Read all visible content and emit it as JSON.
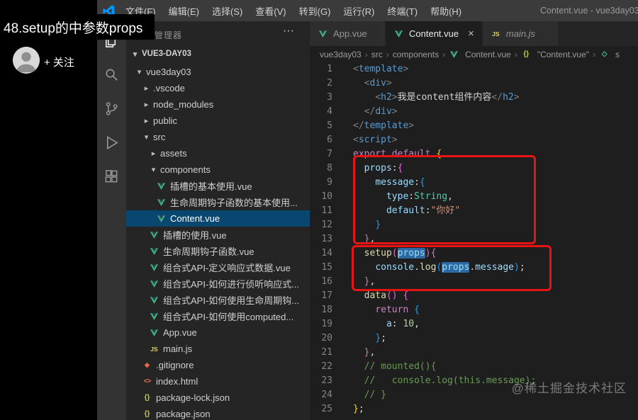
{
  "overlay": {
    "title": "48.setup的中参数props",
    "follow_label": "+ 关注"
  },
  "watermark": "@稀土掘金技术社区",
  "menubar": {
    "items": [
      "文件(F)",
      "编辑(E)",
      "选择(S)",
      "查看(V)",
      "转到(G)",
      "运行(R)",
      "终端(T)",
      "帮助(H)"
    ],
    "window_title": "Content.vue - vue3day03"
  },
  "activity_bar": {
    "icons": [
      "explorer",
      "search",
      "source-control",
      "run-debug",
      "extensions"
    ]
  },
  "explorer": {
    "header": "资源管理器",
    "actions_label": "···",
    "root": "VUE3-DAY03",
    "items": [
      {
        "label": "vue3day03",
        "type": "folder-open",
        "level": 0
      },
      {
        "label": ".vscode",
        "type": "folder",
        "level": 1
      },
      {
        "label": "node_modules",
        "type": "folder",
        "level": 1
      },
      {
        "label": "public",
        "type": "folder",
        "level": 1
      },
      {
        "label": "src",
        "type": "folder-open",
        "level": 1
      },
      {
        "label": "assets",
        "type": "folder",
        "level": 2
      },
      {
        "label": "components",
        "type": "folder-open",
        "level": 2
      },
      {
        "label": "插槽的基本使用.vue",
        "type": "vue",
        "level": 3
      },
      {
        "label": "生命周期钩子函数的基本使用...",
        "type": "vue",
        "level": 3
      },
      {
        "label": "Content.vue",
        "type": "vue",
        "level": 3,
        "selected": true
      },
      {
        "label": "插槽的使用.vue",
        "type": "vue",
        "level": 2
      },
      {
        "label": "生命周期钩子函数.vue",
        "type": "vue",
        "level": 2
      },
      {
        "label": "组合式API-定义响应式数据.vue",
        "type": "vue",
        "level": 2
      },
      {
        "label": "组合式API-如何进行侦听响应式...",
        "type": "vue",
        "level": 2
      },
      {
        "label": "组合式API-如何使用生命周期钩...",
        "type": "vue",
        "level": 2
      },
      {
        "label": "组合式API-如何使用computed...",
        "type": "vue",
        "level": 2
      },
      {
        "label": "App.vue",
        "type": "vue",
        "level": 2
      },
      {
        "label": "main.js",
        "type": "js",
        "level": 2
      },
      {
        "label": ".gitignore",
        "type": "git",
        "level": 1
      },
      {
        "label": "index.html",
        "type": "html",
        "level": 1
      },
      {
        "label": "package-lock.json",
        "type": "json",
        "level": 1
      },
      {
        "label": "package.json",
        "type": "json",
        "level": 1
      }
    ]
  },
  "tabs": [
    {
      "label": "App.vue",
      "icon": "vue"
    },
    {
      "label": "Content.vue",
      "icon": "vue",
      "active": true,
      "close_label": "×"
    },
    {
      "label": "main.js",
      "icon": "js",
      "italic": true
    }
  ],
  "breadcrumb": {
    "items": [
      {
        "label": "vue3day03"
      },
      {
        "label": "src"
      },
      {
        "label": "components"
      },
      {
        "label": "Content.vue",
        "icon": "vue"
      },
      {
        "label": "\"Content.vue\"",
        "icon": "json"
      },
      {
        "label": "s",
        "icon": "sym"
      }
    ]
  },
  "annotation": {
    "color": "#e81313"
  },
  "editor": {
    "lines": [
      {
        "n": 1,
        "tokens": [
          {
            "t": "<",
            "c": "punct"
          },
          {
            "t": "template",
            "c": "tag"
          },
          {
            "t": ">",
            "c": "punct"
          }
        ]
      },
      {
        "n": 2,
        "tokens": [
          {
            "t": "  ",
            "c": "text"
          },
          {
            "t": "<",
            "c": "punct"
          },
          {
            "t": "div",
            "c": "tag"
          },
          {
            "t": ">",
            "c": "punct"
          }
        ]
      },
      {
        "n": 3,
        "tokens": [
          {
            "t": "    ",
            "c": "text"
          },
          {
            "t": "<",
            "c": "punct"
          },
          {
            "t": "h2",
            "c": "tag"
          },
          {
            "t": ">",
            "c": "punct"
          },
          {
            "t": "我是content组件内容",
            "c": "text"
          },
          {
            "t": "</",
            "c": "punct"
          },
          {
            "t": "h2",
            "c": "tag"
          },
          {
            "t": ">",
            "c": "punct"
          }
        ]
      },
      {
        "n": 4,
        "tokens": [
          {
            "t": "  ",
            "c": "text"
          },
          {
            "t": "</",
            "c": "punct"
          },
          {
            "t": "div",
            "c": "tag"
          },
          {
            "t": ">",
            "c": "punct"
          }
        ]
      },
      {
        "n": 5,
        "tokens": [
          {
            "t": "</",
            "c": "punct"
          },
          {
            "t": "template",
            "c": "tag"
          },
          {
            "t": ">",
            "c": "punct"
          }
        ]
      },
      {
        "n": 6,
        "tokens": [
          {
            "t": "<",
            "c": "punct"
          },
          {
            "t": "script",
            "c": "tag"
          },
          {
            "t": ">",
            "c": "punct"
          }
        ]
      },
      {
        "n": 7,
        "tokens": [
          {
            "t": "export",
            "c": "kw"
          },
          {
            "t": " ",
            "c": "text"
          },
          {
            "t": "default",
            "c": "kw"
          },
          {
            "t": " ",
            "c": "text"
          },
          {
            "t": "{",
            "c": "b1"
          }
        ]
      },
      {
        "n": 8,
        "tokens": [
          {
            "t": "  ",
            "c": "text"
          },
          {
            "t": "props",
            "c": "prop"
          },
          {
            "t": ":",
            "c": "text"
          },
          {
            "t": "{",
            "c": "b2"
          }
        ]
      },
      {
        "n": 9,
        "tokens": [
          {
            "t": "    ",
            "c": "text"
          },
          {
            "t": "message",
            "c": "prop"
          },
          {
            "t": ":",
            "c": "text"
          },
          {
            "t": "{",
            "c": "b3"
          }
        ]
      },
      {
        "n": 10,
        "tokens": [
          {
            "t": "      ",
            "c": "text"
          },
          {
            "t": "type",
            "c": "prop"
          },
          {
            "t": ":",
            "c": "text"
          },
          {
            "t": "String",
            "c": "cls"
          },
          {
            "t": ",",
            "c": "text"
          }
        ]
      },
      {
        "n": 11,
        "tokens": [
          {
            "t": "      ",
            "c": "text"
          },
          {
            "t": "default",
            "c": "prop"
          },
          {
            "t": ":",
            "c": "text"
          },
          {
            "t": "\"你好\"",
            "c": "str"
          }
        ]
      },
      {
        "n": 12,
        "tokens": [
          {
            "t": "    ",
            "c": "text"
          },
          {
            "t": "}",
            "c": "b3"
          }
        ]
      },
      {
        "n": 13,
        "tokens": [
          {
            "t": "  ",
            "c": "text"
          },
          {
            "t": "}",
            "c": "b2"
          },
          {
            "t": ",",
            "c": "text"
          }
        ]
      },
      {
        "n": 14,
        "tokens": [
          {
            "t": "  ",
            "c": "text"
          },
          {
            "t": "setup",
            "c": "fn"
          },
          {
            "t": "(",
            "c": "b2"
          },
          {
            "t": "props",
            "c": "prop",
            "hl": true
          },
          {
            "t": ")",
            "c": "b2"
          },
          {
            "t": "{",
            "c": "b2"
          }
        ]
      },
      {
        "n": 15,
        "tokens": [
          {
            "t": "    ",
            "c": "text"
          },
          {
            "t": "console",
            "c": "prop"
          },
          {
            "t": ".",
            "c": "text"
          },
          {
            "t": "log",
            "c": "fn"
          },
          {
            "t": "(",
            "c": "b3"
          },
          {
            "t": "props",
            "c": "prop",
            "hl": true
          },
          {
            "t": ".",
            "c": "text"
          },
          {
            "t": "message",
            "c": "prop"
          },
          {
            "t": ")",
            "c": "b3"
          },
          {
            "t": ";",
            "c": "text"
          }
        ]
      },
      {
        "n": 16,
        "tokens": [
          {
            "t": "  ",
            "c": "text"
          },
          {
            "t": "}",
            "c": "b2"
          },
          {
            "t": ",",
            "c": "text"
          }
        ]
      },
      {
        "n": 17,
        "tokens": [
          {
            "t": "  ",
            "c": "text"
          },
          {
            "t": "data",
            "c": "fn"
          },
          {
            "t": "(",
            "c": "b2"
          },
          {
            "t": ")",
            "c": "b2"
          },
          {
            "t": " ",
            "c": "text"
          },
          {
            "t": "{",
            "c": "b2"
          }
        ]
      },
      {
        "n": 18,
        "tokens": [
          {
            "t": "    ",
            "c": "text"
          },
          {
            "t": "return",
            "c": "kw"
          },
          {
            "t": " ",
            "c": "text"
          },
          {
            "t": "{",
            "c": "b3"
          }
        ]
      },
      {
        "n": 19,
        "tokens": [
          {
            "t": "      ",
            "c": "text"
          },
          {
            "t": "a",
            "c": "prop"
          },
          {
            "t": ":",
            "c": "text"
          },
          {
            "t": " ",
            "c": "text"
          },
          {
            "t": "10",
            "c": "num"
          },
          {
            "t": ",",
            "c": "text"
          }
        ]
      },
      {
        "n": 20,
        "tokens": [
          {
            "t": "    ",
            "c": "text"
          },
          {
            "t": "}",
            "c": "b3"
          },
          {
            "t": ";",
            "c": "text"
          }
        ]
      },
      {
        "n": 21,
        "tokens": [
          {
            "t": "  ",
            "c": "text"
          },
          {
            "t": "}",
            "c": "b2"
          },
          {
            "t": ",",
            "c": "text"
          }
        ]
      },
      {
        "n": 22,
        "tokens": [
          {
            "t": "  ",
            "c": "text"
          },
          {
            "t": "// mounted(){",
            "c": "cmt"
          }
        ]
      },
      {
        "n": 23,
        "tokens": [
          {
            "t": "  ",
            "c": "text"
          },
          {
            "t": "//   console.log(this.message);",
            "c": "cmt"
          }
        ]
      },
      {
        "n": 24,
        "tokens": [
          {
            "t": "  ",
            "c": "text"
          },
          {
            "t": "// }",
            "c": "cmt"
          }
        ]
      },
      {
        "n": 25,
        "tokens": [
          {
            "t": "}",
            "c": "b1"
          },
          {
            "t": ";",
            "c": "text"
          }
        ]
      }
    ]
  }
}
